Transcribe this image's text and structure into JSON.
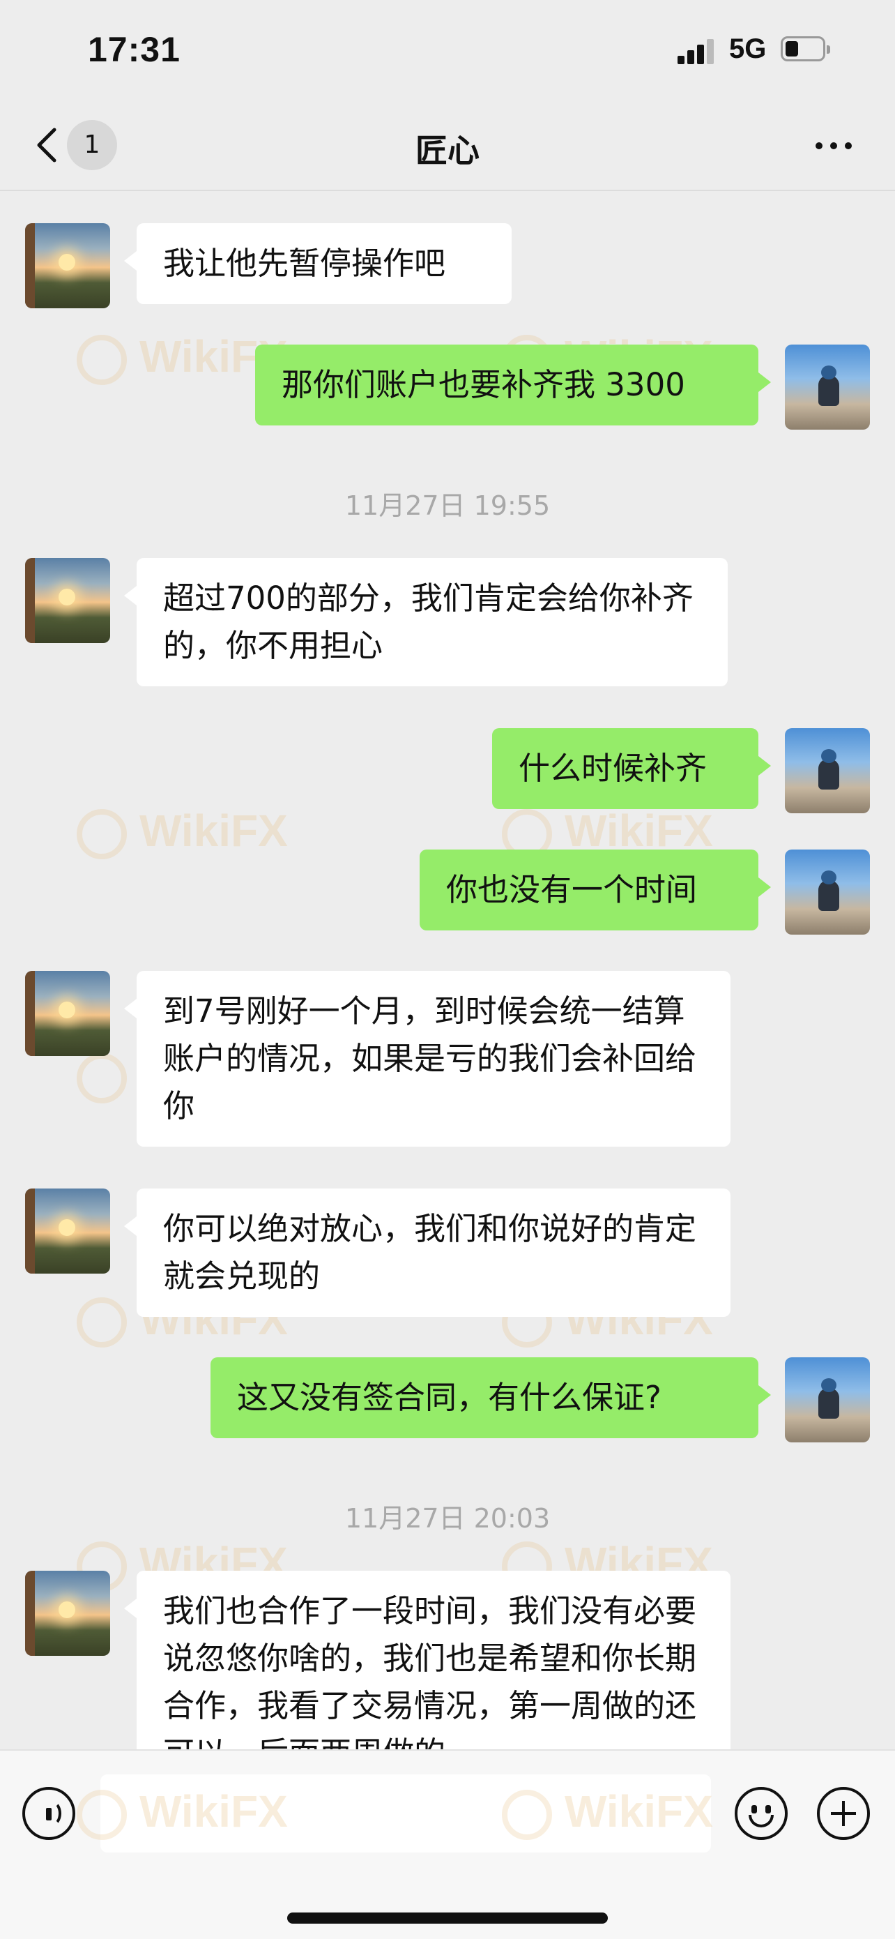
{
  "status_bar": {
    "time": "17:31",
    "network": "5G"
  },
  "nav": {
    "unread_count": "1",
    "title": "匠心"
  },
  "messages": [
    {
      "side": "left",
      "text": "我让他先暂停操作吧"
    },
    {
      "side": "right",
      "text": "那你们账户也要补齐我 3300"
    },
    {
      "type": "timestamp",
      "text": "11月27日 19:55"
    },
    {
      "side": "left",
      "text": "超过700的部分，我们肯定会给你补齐的，你不用担心"
    },
    {
      "side": "right",
      "text": "什么时候补齐"
    },
    {
      "side": "right",
      "text": "你也没有一个时间"
    },
    {
      "side": "left",
      "text": "到7号刚好一个月，到时候会统一结算账户的情况，如果是亏的我们会补回给你"
    },
    {
      "side": "left",
      "text": "你可以绝对放心，我们和你说好的肯定就会兑现的"
    },
    {
      "side": "right",
      "text": "这又没有签合同，有什么保证?"
    },
    {
      "type": "timestamp",
      "text": "11月27日 20:03"
    },
    {
      "side": "left",
      "text": "我们也合作了一段时间，我们没有必要说忽悠你啥的，我们也是希望和你长期合作，我看了交易情况，第一周做的还可以，后面两周做的"
    }
  ],
  "watermark": "WikiFX",
  "icons": {
    "back": "chevron-left-icon",
    "more": "more-dots-icon",
    "voice": "voice-icon",
    "emoji": "emoji-icon",
    "plus": "plus-icon"
  },
  "colors": {
    "sent_bubble": "#95ec69",
    "received_bubble": "#ffffff",
    "background": "#ededed"
  }
}
